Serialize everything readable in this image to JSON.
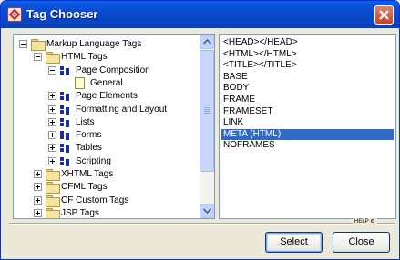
{
  "window": {
    "title": "Tag Chooser",
    "app_icon": "tag-chooser-app-icon",
    "close_icon": "close-icon"
  },
  "tree": {
    "items": [
      {
        "label": "Markup Language Tags",
        "icon": "folder-icon",
        "expander": "minus"
      },
      {
        "label": "HTML Tags",
        "icon": "folder-icon",
        "expander": "minus"
      },
      {
        "label": "Page Composition",
        "icon": "tag-icon",
        "expander": "minus"
      },
      {
        "label": "General",
        "icon": "document-icon",
        "expander": "none"
      },
      {
        "label": "Page Elements",
        "icon": "tag-icon",
        "expander": "plus"
      },
      {
        "label": "Formatting and Layout",
        "icon": "tag-icon",
        "expander": "plus"
      },
      {
        "label": "Lists",
        "icon": "tag-icon",
        "expander": "plus"
      },
      {
        "label": "Forms",
        "icon": "tag-icon",
        "expander": "plus"
      },
      {
        "label": "Tables",
        "icon": "tag-icon",
        "expander": "plus"
      },
      {
        "label": "Scripting",
        "icon": "tag-icon",
        "expander": "plus"
      },
      {
        "label": "XHTML Tags",
        "icon": "folder-icon",
        "expander": "plus"
      },
      {
        "label": "CFML Tags",
        "icon": "folder-icon",
        "expander": "plus"
      },
      {
        "label": "CF Custom Tags",
        "icon": "folder-icon",
        "expander": "plus"
      },
      {
        "label": "JSP Tags",
        "icon": "folder-icon",
        "expander": "plus"
      }
    ]
  },
  "tag_list": {
    "items": [
      "<HEAD></HEAD>",
      "<HTML></HTML>",
      "<TITLE></TITLE>",
      "BASE",
      "BODY",
      "FRAME",
      "FRAMESET",
      "LINK",
      "META (HTML)",
      "NOFRAMES"
    ],
    "selected": "META (HTML)"
  },
  "help_label": "HELP",
  "buttons": {
    "select": "Select",
    "close": "Close"
  },
  "colors": {
    "selection": "#316ac5",
    "titlebar": "#0a4ad0"
  }
}
